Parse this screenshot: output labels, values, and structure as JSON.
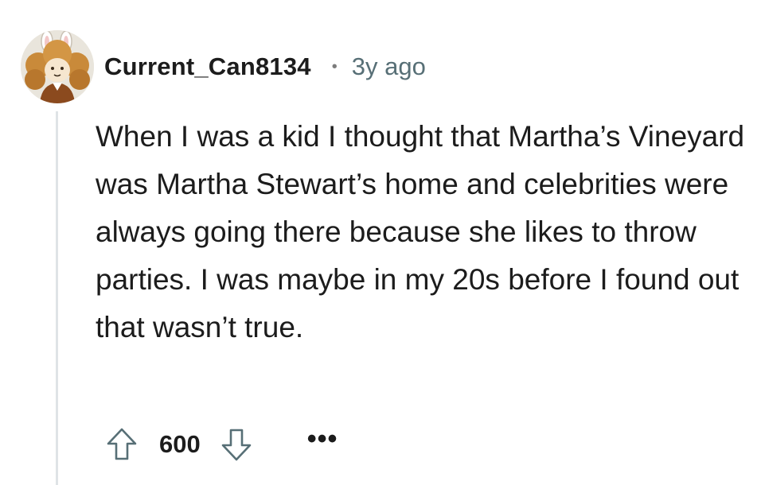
{
  "comment": {
    "author": "Current_Can8134",
    "separator": "•",
    "age": "3y ago",
    "body": "When I was a kid I thought that Martha’s Vineyard was Martha Stewart’s home and celebrities were always going there because she likes to throw parties. I was maybe in my 20s before I found out that wasn’t true.",
    "score": "600",
    "more_label": "•••"
  },
  "icons": {
    "upvote": "upvote-arrow-icon",
    "downvote": "downvote-arrow-icon",
    "avatar": "avatar-image"
  },
  "colors": {
    "text": "#1c1c1c",
    "meta": "#576f76",
    "thread_line": "#dfe3e6",
    "icon_stroke": "#576f76"
  }
}
